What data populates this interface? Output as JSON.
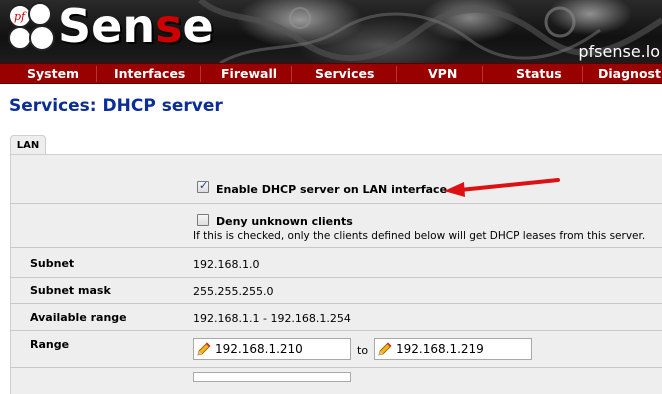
{
  "app": {
    "brand_prefix": "pf",
    "brand_part1": "Sen",
    "brand_part2": "s",
    "brand_part3": "e",
    "hostname": "pfsense.lo"
  },
  "nav": [
    "System",
    "Interfaces",
    "Firewall",
    "Services",
    "VPN",
    "Status",
    "Diagnostic"
  ],
  "page": {
    "title": "Services: DHCP server"
  },
  "tab": "LAN",
  "form": {
    "enable": {
      "checked": true,
      "label": "Enable DHCP server on LAN interface"
    },
    "deny": {
      "checked": false,
      "label": "Deny unknown clients",
      "help": "If this is checked, only the clients defined below will get DHCP leases from this server."
    },
    "subnet": {
      "label": "Subnet",
      "value": "192.168.1.0"
    },
    "subnet_mask": {
      "label": "Subnet mask",
      "value": "255.255.255.0"
    },
    "available_range": {
      "label": "Available range",
      "value": "192.168.1.1 - 192.168.1.254"
    },
    "range": {
      "label": "Range",
      "from": "192.168.1.210",
      "to_label": "to",
      "to": "192.168.1.219"
    }
  },
  "colors": {
    "nav_bg": "#990000",
    "title": "#0b2d96",
    "arrow": "#dd1111",
    "panel": "#eeeeee"
  }
}
